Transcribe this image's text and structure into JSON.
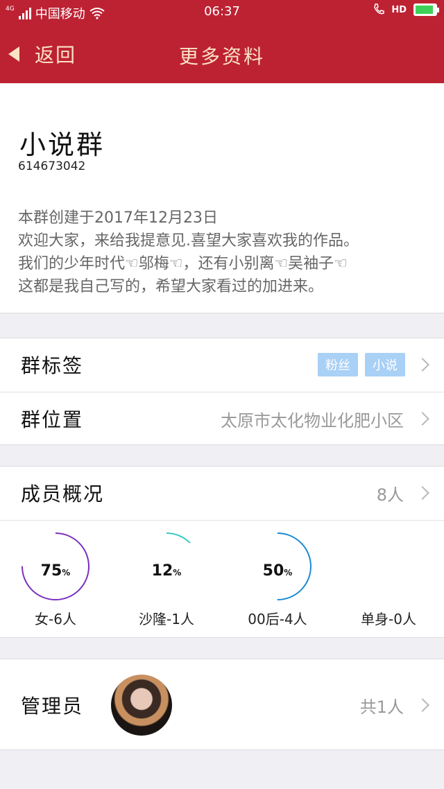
{
  "status_bar": {
    "network": "4G",
    "carrier": "中国移动",
    "time": "06:37",
    "hd": "HD",
    "battery_level": 0.9,
    "battery_color": "#3dd15a"
  },
  "nav": {
    "back_label": "返回",
    "title": "更多资料",
    "bg_color": "#bd2233"
  },
  "group": {
    "name": "小说群",
    "id": "614673042",
    "intro": "本群创建于2017年12月23日\n欢迎大家，来给我提意见.喜望大家喜欢我的作品。\n我们的少年时代☜邬梅☜，还有小别离☜吴袖子☜\n这都是我自己写的，希望大家看过的加进来。"
  },
  "tags_row": {
    "label": "群标签",
    "tags": [
      "粉丝",
      "小说"
    ]
  },
  "location_row": {
    "label": "群位置",
    "value": "太原市太化物业化肥小区"
  },
  "members_row": {
    "label": "成员概况",
    "value": "8人"
  },
  "stats": [
    {
      "percent": "75",
      "unit": "%",
      "label": "女-6人",
      "fraction": 0.75,
      "color": "#7b2fbe"
    },
    {
      "percent": "12",
      "unit": "%",
      "label": "沙隆-1人",
      "fraction": 0.125,
      "color": "#39c9c3"
    },
    {
      "percent": "50",
      "unit": "%",
      "label": "00后-4人",
      "fraction": 0.5,
      "color": "#1a8ad4"
    },
    {
      "percent": "",
      "unit": "",
      "label": "单身-0人",
      "fraction": 0,
      "color": "#cccccc"
    }
  ],
  "admin_row": {
    "label": "管理员",
    "value": "共1人"
  }
}
